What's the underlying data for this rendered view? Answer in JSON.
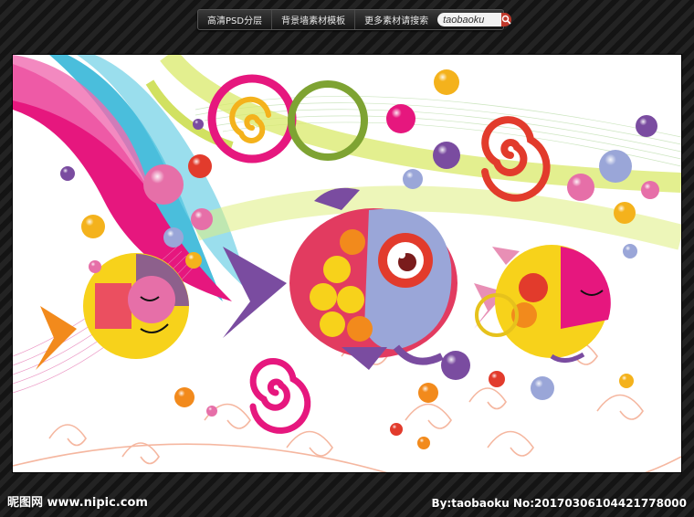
{
  "topbar": {
    "links": [
      "高清PSD分层",
      "背景墙素材模板",
      "更多素材请搜索"
    ],
    "search_value": "taobaoku"
  },
  "watermark": {
    "site": "昵图网 www.nipic.com",
    "credit": "By:taobaoku No:20170306104421778000"
  },
  "icons": {
    "search": "search-icon"
  },
  "colors": {
    "magenta": "#e6177e",
    "yellow": "#f7d21b",
    "orange": "#f28a1c",
    "red": "#e23b2c",
    "purple": "#7a4ca0",
    "lime": "#c5d93a",
    "cyan": "#2ab3d6"
  }
}
